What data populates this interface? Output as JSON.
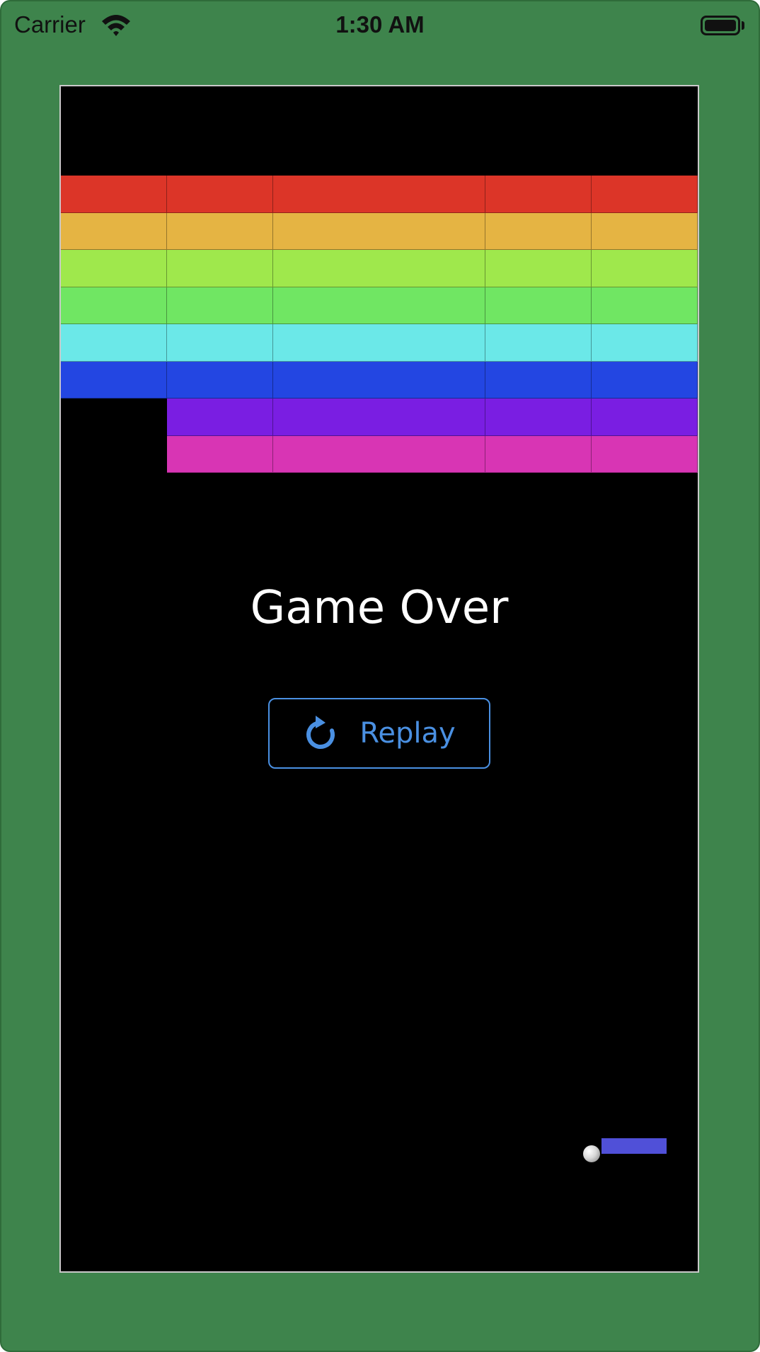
{
  "status_bar": {
    "carrier": "Carrier",
    "time": "1:30 AM",
    "wifi_icon": "wifi-icon",
    "battery_icon": "battery-icon",
    "battery_level": 1.0
  },
  "game": {
    "message": "Game Over",
    "replay_button": {
      "label": "Replay",
      "icon": "refresh-icon",
      "color": "#4a90e2"
    },
    "background_color": "#000000",
    "ball_icon": "ball",
    "paddle_color": "#5050d8",
    "brick_rows": [
      {
        "color": "#dc3528",
        "present": [
          true,
          true,
          true,
          true,
          true
        ]
      },
      {
        "color": "#e5b443",
        "present": [
          true,
          true,
          true,
          true,
          true
        ]
      },
      {
        "color": "#9fe84c",
        "present": [
          true,
          true,
          true,
          true,
          true
        ]
      },
      {
        "color": "#70e663",
        "present": [
          true,
          true,
          true,
          true,
          true
        ]
      },
      {
        "color": "#6be8e8",
        "present": [
          true,
          true,
          true,
          true,
          true
        ]
      },
      {
        "color": "#2346e2",
        "present": [
          true,
          true,
          true,
          true,
          true
        ]
      },
      {
        "color": "#7a1ee2",
        "present": [
          false,
          true,
          true,
          true,
          true
        ]
      },
      {
        "color": "#d835b4",
        "present": [
          false,
          true,
          true,
          true,
          true
        ]
      }
    ]
  },
  "frame_color": "#3e844c"
}
